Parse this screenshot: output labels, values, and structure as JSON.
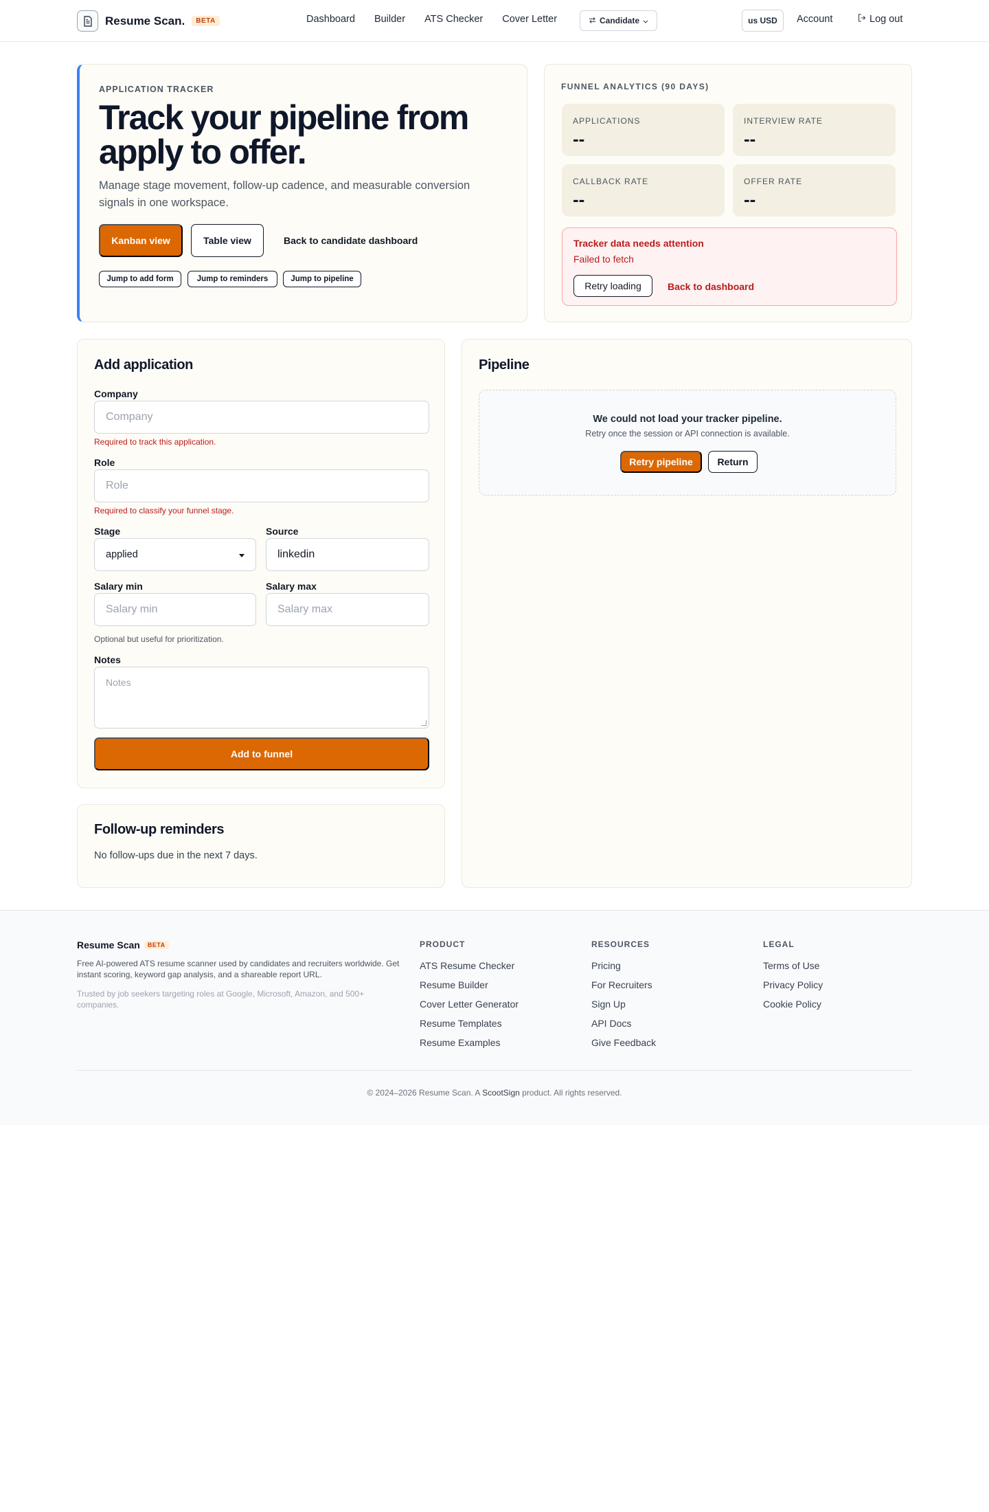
{
  "header": {
    "brand": "Resume Scan.",
    "beta": "BETA",
    "nav": [
      "Dashboard",
      "Builder",
      "ATS Checker",
      "Cover Letter"
    ],
    "role": "Candidate",
    "currency": "us USD",
    "account": "Account",
    "logout": "Log out"
  },
  "hero": {
    "eyebrow": "APPLICATION TRACKER",
    "title": "Track your pipeline from apply to offer.",
    "subtitle": "Manage stage movement, follow-up cadence, and measurable conversion signals in one workspace.",
    "kanban_label": "Kanban view",
    "table_label": "Table view",
    "back_label": "Back to candidate dashboard",
    "chips": [
      "Jump to add form",
      "Jump to reminders",
      "Jump to pipeline"
    ]
  },
  "funnel": {
    "title": "FUNNEL ANALYTICS (90 DAYS)",
    "stats": [
      {
        "label": "APPLICATIONS",
        "value": "--"
      },
      {
        "label": "INTERVIEW RATE",
        "value": "--"
      },
      {
        "label": "CALLBACK RATE",
        "value": "--"
      },
      {
        "label": "OFFER RATE",
        "value": "--"
      }
    ],
    "alert": {
      "title": "Tracker data needs attention",
      "message": "Failed to fetch",
      "retry": "Retry loading",
      "back": "Back to dashboard"
    }
  },
  "form": {
    "title": "Add application",
    "company_label": "Company",
    "company_placeholder": "Company",
    "company_error": "Required to track this application.",
    "role_label": "Role",
    "role_placeholder": "Role",
    "role_error": "Required to classify your funnel stage.",
    "stage_label": "Stage",
    "stage_value": "applied",
    "source_label": "Source",
    "source_value": "linkedin",
    "salary_min_label": "Salary min",
    "salary_min_placeholder": "Salary min",
    "salary_max_label": "Salary max",
    "salary_max_placeholder": "Salary max",
    "salary_hint": "Optional but useful for prioritization.",
    "notes_label": "Notes",
    "notes_placeholder": "Notes",
    "submit": "Add to funnel"
  },
  "reminders": {
    "title": "Follow-up reminders",
    "empty": "No follow-ups due in the next 7 days."
  },
  "pipeline": {
    "title": "Pipeline",
    "error_title": "We could not load your tracker pipeline.",
    "error_sub": "Retry once the session or API connection is available.",
    "retry": "Retry pipeline",
    "return": "Return"
  },
  "footer": {
    "brand": "Resume Scan",
    "beta": "BETA",
    "description": "Free AI-powered ATS resume scanner used by candidates and recruiters worldwide. Get instant scoring, keyword gap analysis, and a shareable report URL.",
    "trust": "Trusted by job seekers targeting roles at Google, Microsoft, Amazon, and 500+ companies.",
    "columns": [
      {
        "heading": "PRODUCT",
        "links": [
          "ATS Resume Checker",
          "Resume Builder",
          "Cover Letter Generator",
          "Resume Templates",
          "Resume Examples"
        ]
      },
      {
        "heading": "RESOURCES",
        "links": [
          "Pricing",
          "For Recruiters",
          "Sign Up",
          "API Docs",
          "Give Feedback"
        ]
      },
      {
        "heading": "LEGAL",
        "links": [
          "Terms of Use",
          "Privacy Policy",
          "Cookie Policy"
        ]
      }
    ],
    "copyright_pre": "© 2024–2026 Resume Scan. A",
    "copyright_brand": "ScootSign",
    "copyright_post": "product. All rights reserved."
  },
  "colors": {
    "accent": "#dc6803",
    "hero_border": "#3b82f6",
    "error": "#b91c1c",
    "card_bg": "#fefcf6"
  }
}
